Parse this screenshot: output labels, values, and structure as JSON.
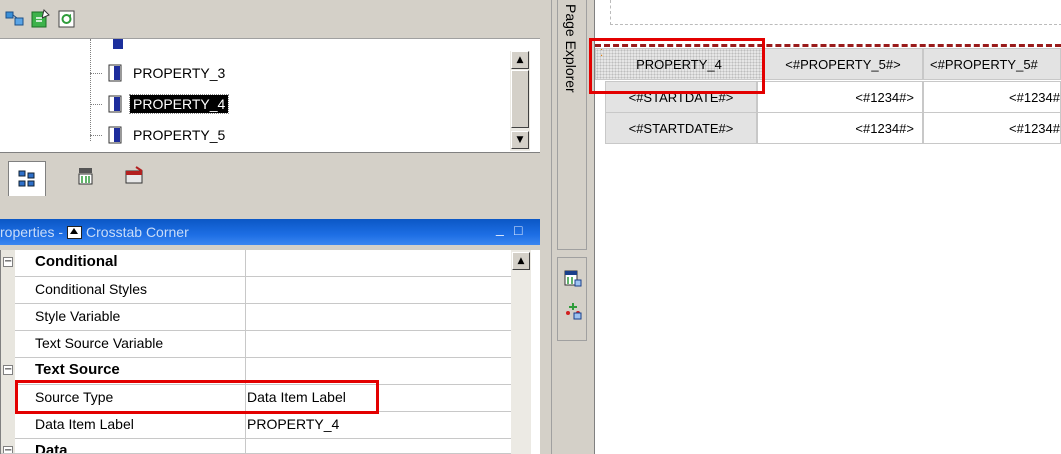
{
  "toolbar": {
    "icons": [
      "insertable-objects-icon",
      "refresh-green-icon",
      "data-items-icon"
    ]
  },
  "tree": {
    "items": [
      {
        "label": "PROPERTY_3",
        "selected": false
      },
      {
        "label": "PROPERTY_4",
        "selected": true
      },
      {
        "label": "PROPERTY_5",
        "selected": false
      }
    ]
  },
  "tabs": {
    "icons": [
      "source-tab-icon",
      "data-items-tab-icon",
      "toolbox-tab-icon"
    ]
  },
  "properties": {
    "header_prefix": "roperties - ",
    "header_object": "Crosstab Corner",
    "header_minimize": "_",
    "header_maximize": "□",
    "rows": [
      {
        "type": "category",
        "expander": "⊟",
        "name": "Conditional",
        "value": ""
      },
      {
        "type": "property",
        "name": "Conditional Styles",
        "value": ""
      },
      {
        "type": "property",
        "name": "Style Variable",
        "value": ""
      },
      {
        "type": "property",
        "name": "Text Source Variable",
        "value": ""
      },
      {
        "type": "category",
        "expander": "⊟",
        "name": "Text Source",
        "value": ""
      },
      {
        "type": "property",
        "name": "Source Type",
        "value": "Data Item Label"
      },
      {
        "type": "property",
        "name": "Data Item Label",
        "value": "PROPERTY_4"
      },
      {
        "type": "category",
        "expander": "⊟",
        "name": "Data",
        "value": ""
      }
    ]
  },
  "side_panel": {
    "page_explorer_label": "Page Explorer"
  },
  "crosstab": {
    "corner": "PROPERTY_4",
    "column_headers": [
      "<#PROPERTY_5#>",
      "<#PROPERTY_5#"
    ],
    "rows": [
      {
        "header": "<#STARTDATE#>",
        "values": [
          "<#1234#>",
          "<#1234#"
        ]
      },
      {
        "header": "<#STARTDATE#>",
        "values": [
          "<#1234#>",
          "<#1234#"
        ]
      }
    ]
  },
  "colors": {
    "highlight_box": "#e30000",
    "title_bar": "#1d6ee4",
    "panel_bg": "#d4d0c8"
  }
}
